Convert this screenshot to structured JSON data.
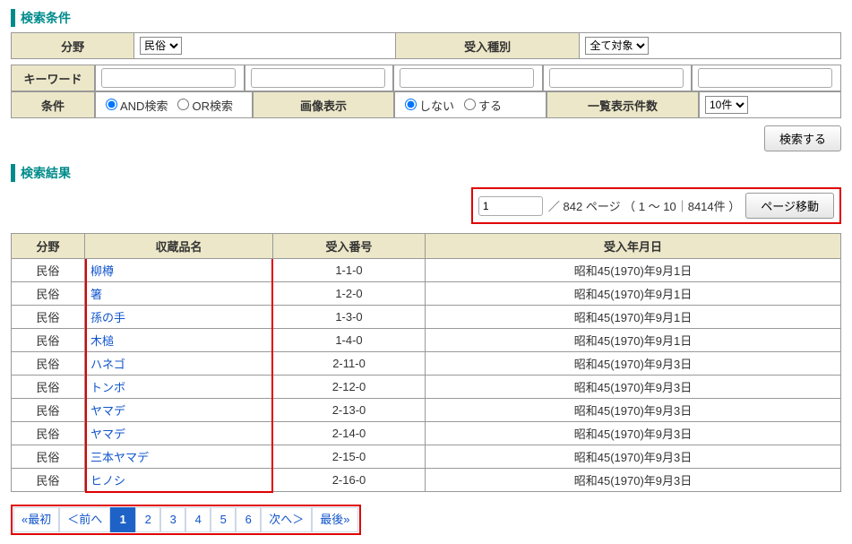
{
  "sections": {
    "search_cond": "検索条件",
    "search_result": "検索結果"
  },
  "labels": {
    "field": "分野",
    "accept_type": "受入種別",
    "keyword": "キーワード",
    "condition": "条件",
    "image_display": "画像表示",
    "list_count": "一覧表示件数"
  },
  "selects": {
    "field_value": "民俗",
    "accept_type_value": "全て対象",
    "list_count_value": "10件"
  },
  "radios": {
    "and_label": "AND検索",
    "or_label": "OR検索",
    "img_off_label": "しない",
    "img_on_label": "する"
  },
  "buttons": {
    "search": "検索する",
    "page_move": "ページ移動"
  },
  "pagebar": {
    "current": "1",
    "info": "／ 842 ページ （ 1 ～ 10｜8414件 ）"
  },
  "columns": {
    "field": "分野",
    "name": "収蔵品名",
    "num": "受入番号",
    "date": "受入年月日"
  },
  "rows": [
    {
      "field": "民俗",
      "name": "柳樽",
      "num": "1-1-0",
      "date": "昭和45(1970)年9月1日"
    },
    {
      "field": "民俗",
      "name": "箸",
      "num": "1-2-0",
      "date": "昭和45(1970)年9月1日"
    },
    {
      "field": "民俗",
      "name": "孫の手",
      "num": "1-3-0",
      "date": "昭和45(1970)年9月1日"
    },
    {
      "field": "民俗",
      "name": "木槌",
      "num": "1-4-0",
      "date": "昭和45(1970)年9月1日"
    },
    {
      "field": "民俗",
      "name": "ハネゴ",
      "num": "2-11-0",
      "date": "昭和45(1970)年9月3日"
    },
    {
      "field": "民俗",
      "name": "トンボ",
      "num": "2-12-0",
      "date": "昭和45(1970)年9月3日"
    },
    {
      "field": "民俗",
      "name": "ヤマデ",
      "num": "2-13-0",
      "date": "昭和45(1970)年9月3日"
    },
    {
      "field": "民俗",
      "name": "ヤマデ",
      "num": "2-14-0",
      "date": "昭和45(1970)年9月3日"
    },
    {
      "field": "民俗",
      "name": "三本ヤマデ",
      "num": "2-15-0",
      "date": "昭和45(1970)年9月3日"
    },
    {
      "field": "民俗",
      "name": "ヒノシ",
      "num": "2-16-0",
      "date": "昭和45(1970)年9月3日"
    }
  ],
  "pager": {
    "first": "«最初",
    "prev": "＜前へ",
    "pages": [
      "1",
      "2",
      "3",
      "4",
      "5",
      "6"
    ],
    "current": "1",
    "next": "次へ＞",
    "last": "最後»"
  }
}
